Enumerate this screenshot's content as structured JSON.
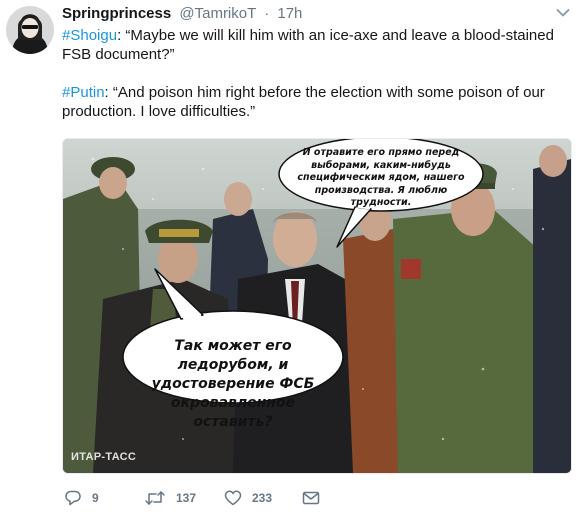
{
  "tweet": {
    "display_name": "Springprincess",
    "handle": "@TamrikoT",
    "separator": "·",
    "time": "17h",
    "para1_hashtag": "#Shoigu",
    "para1_text": ": “Maybe we will kill him with an ice-axe and leave a blood-stained FSB document?”",
    "para2_hashtag": "#Putin",
    "para2_text": ": “And poison him right before the election with some poison of our production. I love difficulties.”"
  },
  "media": {
    "bubble_top": "И отравите его прямо перед выборами, каким-нибудь специфическим ядом, нашего производства. Я люблю трудности.",
    "bubble_bottom": "Так может его ледорубом, и удостоверение ФСБ окровавленное оставить?",
    "watermark": "ИТАР-ТАСС"
  },
  "actions": {
    "reply_count": "9",
    "retweet_count": "137",
    "like_count": "233"
  },
  "icons": {
    "reply": "reply-icon",
    "retweet": "retweet-icon",
    "like": "heart-icon",
    "dm": "envelope-icon",
    "more": "chevron-down-icon"
  },
  "colors": {
    "hashtag": "#1b95e0",
    "meta": "#657786",
    "text": "#14171a"
  }
}
